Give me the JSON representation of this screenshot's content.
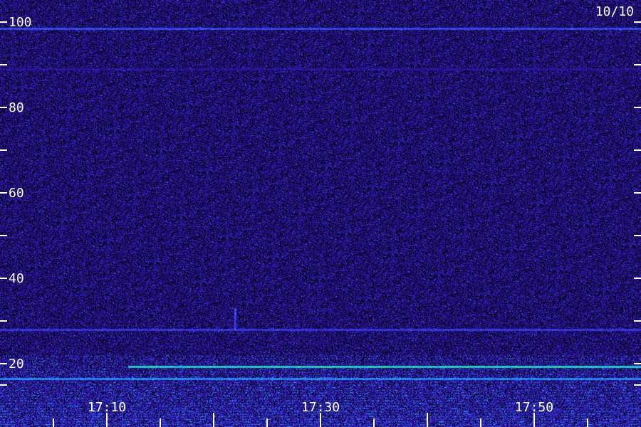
{
  "chart_data": {
    "type": "heatmap",
    "date_label": "10/10",
    "y_axis": {
      "range": [
        15,
        100
      ],
      "labeled_ticks": [
        20,
        40,
        60,
        80,
        100
      ],
      "minor_ticks": [
        30,
        50,
        70,
        90
      ],
      "tick_labels": [
        "20",
        "40",
        "60",
        "80",
        "100"
      ]
    },
    "x_axis": {
      "range": [
        "17:05",
        "17:55"
      ],
      "labeled_ticks": [
        "17:10",
        "17:30",
        "17:50"
      ],
      "tick_labels": [
        "17:10",
        "17:30",
        "17:50"
      ],
      "minor_tick_interval_minutes": 5
    },
    "colormap": [
      "#000000",
      "#1a0a5e",
      "#3a1fd0",
      "#2f7bff",
      "#18c8d8",
      "#3cf07a"
    ],
    "background_level": "low",
    "features": [
      {
        "kind": "horizontal_line",
        "y": 98.5,
        "intensity": 0.55
      },
      {
        "kind": "horizontal_line",
        "y": 89,
        "intensity": 0.3
      },
      {
        "kind": "horizontal_line",
        "y": 28,
        "intensity": 0.5
      },
      {
        "kind": "horizontal_line",
        "y": 19.3,
        "intensity": 0.95,
        "start": "17:12"
      },
      {
        "kind": "horizontal_line",
        "y": 16.5,
        "intensity": 0.7
      },
      {
        "kind": "vertical_line",
        "x": "17:22",
        "y_range": [
          28,
          33
        ],
        "intensity": 0.6
      },
      {
        "kind": "low_band",
        "y_range": [
          15,
          22
        ],
        "intensity": 0.8
      }
    ]
  }
}
